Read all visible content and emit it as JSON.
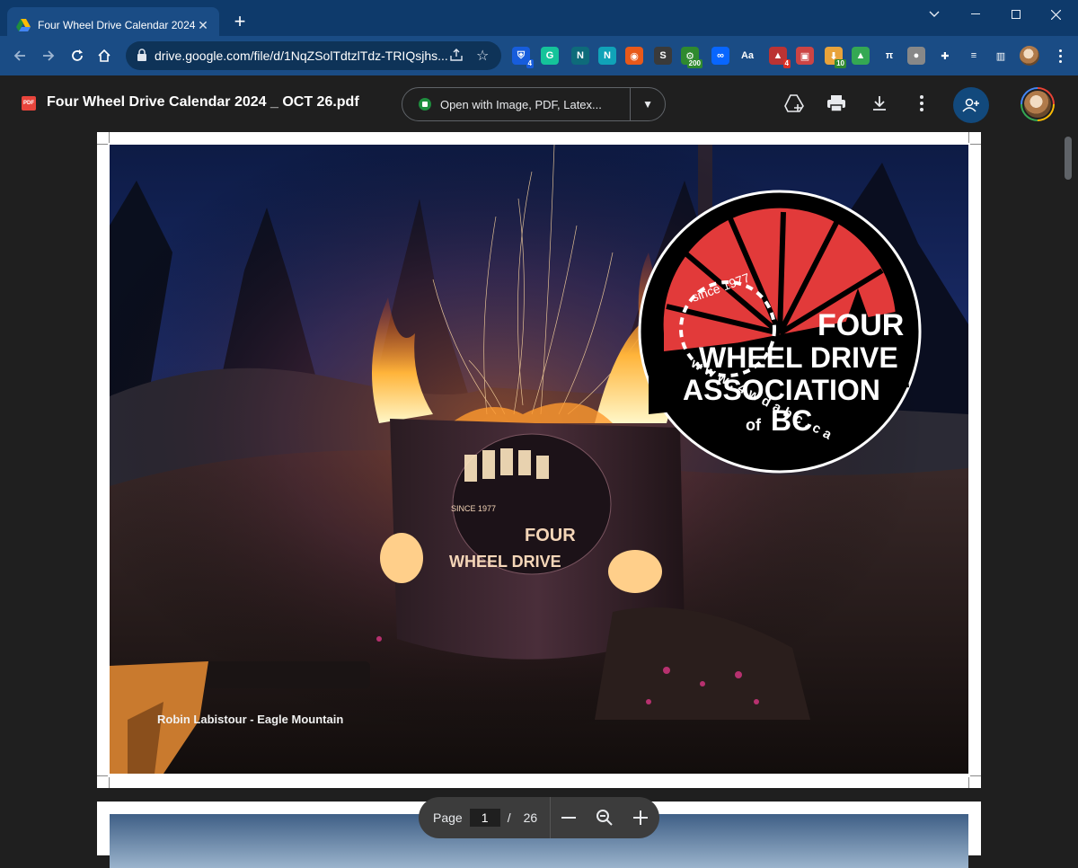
{
  "browser": {
    "tab": {
      "title": "Four Wheel Drive Calendar 2024 _ OCT 26.pdf"
    },
    "url": "drive.google.com/file/d/1NqZSolTdtzlTdz-TRIQsjhs...",
    "extensions": [
      {
        "name": "bitwarden-icon",
        "glyph": "⛨",
        "color": "#175ddc",
        "badge": "4"
      },
      {
        "name": "grammarly-icon",
        "glyph": "G",
        "color": "#15c39a"
      },
      {
        "name": "notion-n-icon",
        "glyph": "N",
        "color": "#0e6b7a"
      },
      {
        "name": "n-extension-icon",
        "glyph": "N",
        "color": "#10a3b8"
      },
      {
        "name": "chrome-ext-icon",
        "glyph": "◉",
        "color": "#e8591a"
      },
      {
        "name": "s-extension-icon",
        "glyph": "S",
        "color": "#3a3a3a"
      },
      {
        "name": "counter-extension-icon",
        "glyph": "⚙",
        "color": "#2f8a2f",
        "badge": "200"
      },
      {
        "name": "meta-icon",
        "glyph": "∞",
        "color": "#0866ff"
      },
      {
        "name": "translate-icon",
        "glyph": "Aa",
        "color": "#1a4c85"
      },
      {
        "name": "alert-extension-icon",
        "glyph": "▲",
        "color": "#b33",
        "badge": "4"
      },
      {
        "name": "printer-extension-icon",
        "glyph": "▣",
        "color": "#c44"
      },
      {
        "name": "download-extension-icon",
        "glyph": "⬇",
        "color": "#e8a33b",
        "badge": "10"
      },
      {
        "name": "google-drive-icon",
        "glyph": "▲",
        "color": "#34a853"
      },
      {
        "name": "pi-icon",
        "glyph": "π",
        "color": "#1a4c85"
      },
      {
        "name": "robot-icon",
        "glyph": "●",
        "color": "#888"
      },
      {
        "name": "extensions-puzzle-icon",
        "glyph": "✚",
        "color": "#1a4c85"
      },
      {
        "name": "media-control-icon",
        "glyph": "≡",
        "color": "#1a4c85"
      },
      {
        "name": "side-panel-icon",
        "glyph": "▥",
        "color": "#1a4c85"
      }
    ]
  },
  "viewer": {
    "doc_title": "Four Wheel Drive Calendar 2024 _ OCT 26.pdf",
    "open_with_label": "Open with Image, PDF, Latex...",
    "photo_caption": "Robin Labistour - Eagle Mountain",
    "logo": {
      "since": "since 1977",
      "line1": "FOUR",
      "line2": "WHEEL DRIVE",
      "line3": "ASSOCIATION",
      "of": "of",
      "bc": "BC",
      "website": "www.4wdabc.ca"
    },
    "firepit_text": {
      "line1": "FOUR",
      "line2": "WHEEL DRIVE",
      "since": "SINCE 1977"
    },
    "page_control": {
      "label": "Page",
      "current": "1",
      "separator": "/",
      "total": "26"
    }
  }
}
